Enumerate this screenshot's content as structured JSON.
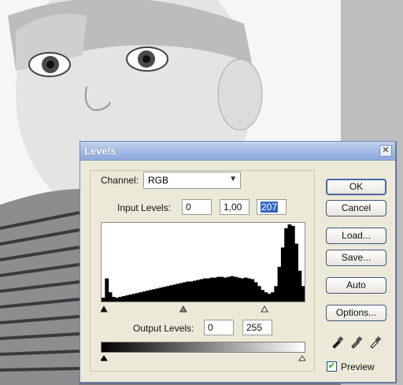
{
  "dialog": {
    "title": "Levels",
    "close_glyph": "✕",
    "channel": {
      "label": "Channel:",
      "value": "RGB"
    },
    "input_levels": {
      "label": "Input Levels:",
      "black": "0",
      "gamma": "1,00",
      "white": "207"
    },
    "output_levels": {
      "label": "Output Levels:",
      "black": "0",
      "white": "255"
    },
    "buttons": {
      "ok": "OK",
      "cancel": "Cancel",
      "load": "Load...",
      "save": "Save...",
      "auto": "Auto",
      "options": "Options..."
    },
    "preview": {
      "label": "Preview",
      "checked": true
    },
    "histogram": {
      "values": [
        0.05,
        0.3,
        0.12,
        0.06,
        0.05,
        0.06,
        0.07,
        0.08,
        0.09,
        0.1,
        0.11,
        0.12,
        0.13,
        0.14,
        0.15,
        0.16,
        0.17,
        0.18,
        0.19,
        0.2,
        0.21,
        0.22,
        0.23,
        0.24,
        0.25,
        0.26,
        0.26,
        0.27,
        0.28,
        0.29,
        0.3,
        0.3,
        0.31,
        0.31,
        0.32,
        0.32,
        0.31,
        0.32,
        0.33,
        0.32,
        0.31,
        0.3,
        0.31,
        0.3,
        0.29,
        0.25,
        0.2,
        0.15,
        0.12,
        0.1,
        0.12,
        0.2,
        0.45,
        0.7,
        0.95,
        1.0,
        0.98,
        0.75,
        0.4,
        0.2
      ],
      "input_black_pct": 0,
      "input_gamma_pct": 40,
      "input_white_pct": 81
    },
    "icons": [
      "close-icon",
      "black-eyedropper-icon",
      "gray-eyedropper-icon",
      "white-eyedropper-icon",
      "chevron-down-icon",
      "checkmark-icon"
    ]
  }
}
